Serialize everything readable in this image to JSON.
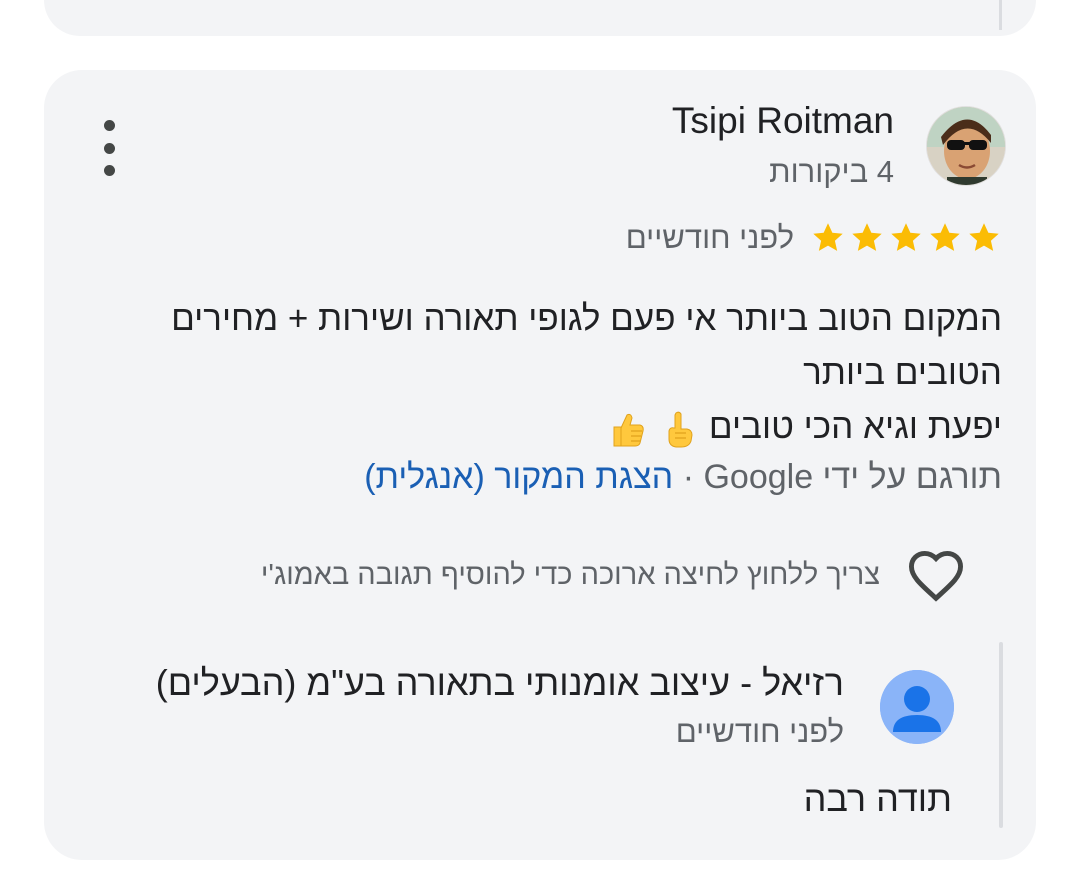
{
  "review": {
    "author_name": "Tsipi Roitman",
    "review_count": "4 ביקורות",
    "rating": 5,
    "date": "לפני חודשיים",
    "text_lines": [
      "המקום הטוב ביותר אי פעם לגופי תאורה ושירות + מחירים הטובים ביותר",
      "יפעת וגיא הכי טובים"
    ],
    "emojis": [
      "index-pointing-up-emoji",
      "thumbs-up-emoji"
    ],
    "translated_by": "תורגם על ידי Google",
    "separator": "·",
    "show_original": "הצגת המקור (אנגלית)",
    "like_hint": "צריך ללחוץ לחיצה ארוכה כדי להוסיף תגובה באמוג'י",
    "icons": {
      "menu": "more-vert-icon",
      "like": "heart-outline-icon",
      "star": "star-icon"
    },
    "colors": {
      "star": "#fbbc04",
      "link": "#1a5fb4",
      "card_bg": "#f3f4f6",
      "owner_avatar": "#8ab4f8"
    }
  },
  "owner_reply": {
    "name": "רזיאל - עיצוב אומנותי בתאורה בע\"מ (הבעלים)",
    "date": "לפני חודשיים",
    "text": "תודה רבה"
  }
}
